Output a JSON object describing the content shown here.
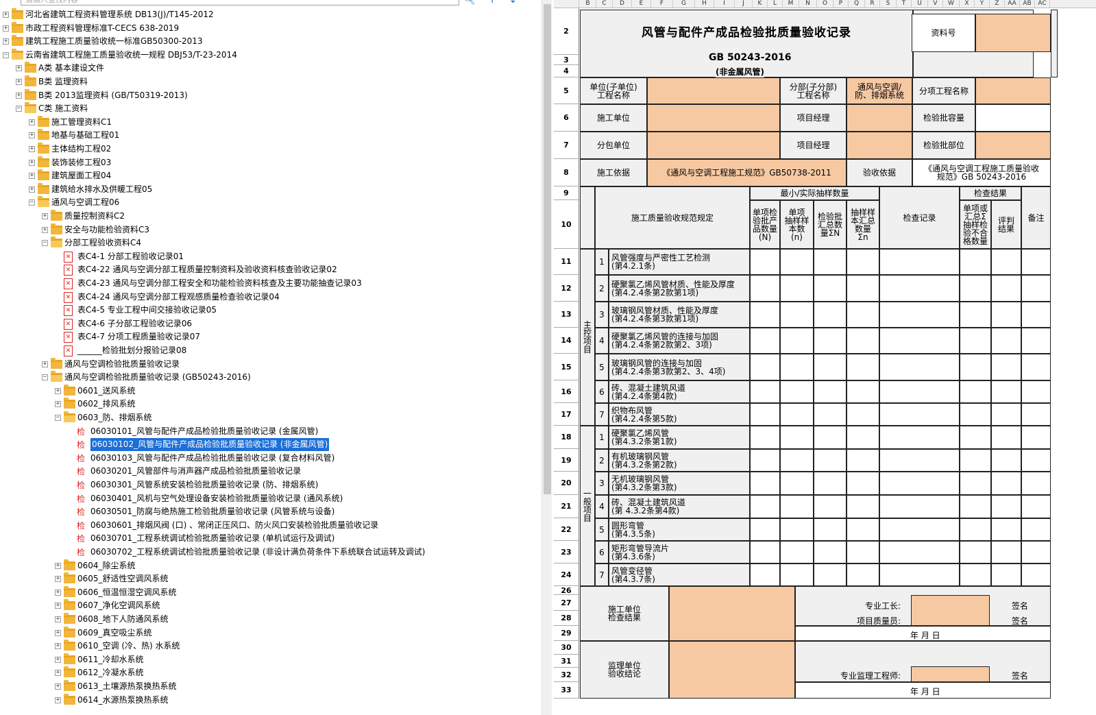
{
  "search": {
    "placeholder": "请输入查找内容"
  },
  "tree": {
    "n0": "河北省建筑工程资料管理系统 DB13(J)/T145-2012",
    "n1": "市政工程资料管理标准T-CECS 638-2019",
    "n2": "建筑工程施工质量验收统一标准GB50300-2013",
    "n3": "云南省建筑工程施工质量验收统一规程 DBJ53/T-23-2014",
    "n4": "A类 基本建设文件",
    "n5": "B类 监理资料",
    "n6": "B类 2013监理资料 (GB/T50319-2013)",
    "n7": "C类 施工资料",
    "n8": "施工管理资料C1",
    "n9": "地基与基础工程01",
    "n10": "主体结构工程02",
    "n11": "装饰装修工程03",
    "n12": "建筑屋面工程04",
    "n13": "建筑给水排水及供暖工程05",
    "n14": "通风与空调工程06",
    "n15": "质量控制资料C2",
    "n16": "安全与功能检验资料C3",
    "n17": "分部工程验收资料C4",
    "n18": "表C4-1 分部工程验收记录01",
    "n19": "表C4-22 通风与空调分部工程质量控制资料及验收资料核查验收记录02",
    "n20": "表C4-23 通风与空调分部工程安全和功能检验资料核查及主要功能抽查记录03",
    "n21": "表C4-24 通风与空调分部工程观感质量检查验收记录04",
    "n22": "表C4-5 专业工程中间交接验收记录05",
    "n23": "表C4-6 子分部工程验收记录06",
    "n24": "表C4-7 分项工程质量验收记录07",
    "n25": "______检验批划分报验记录08",
    "n26": "通风与空调检验批质量验收记录",
    "n27": "通风与空调检验批质量验收记录 (GB50243-2016)",
    "n28": "0601_送风系统",
    "n29": "0602_排风系统",
    "n30": "0603_防、排烟系统",
    "n31": "06030101_风管与配件产成品检验批质量验收记录 (金属风管)",
    "n32": "06030102_风管与配件产成品检验批质量验收记录 (非金属风管)",
    "n33": "06030103_风管与配件产成品检验批质量验收记录 (复合材料风管)",
    "n34": "06030201_风管部件与消声器产成品检验批质量验收记录",
    "n35": "06030301_风管系统安装检验批质量验收记录 (防、排烟系统)",
    "n36": "06030401_风机与空气处理设备安装检验批质量验收记录 (通风系统)",
    "n37": "06030501_防腐与绝热施工检验批质量验收记录 (风管系统与设备)",
    "n38": "06030601_排烟风阀 (口) 、常闭正压风口、防火风口安装检验批质量验收记录",
    "n39": "06030701_工程系统调试检验批质量验收记录 (单机试运行及调试)",
    "n40": "06030702_工程系统调试检验批质量验收记录 (非设计满负荷条件下系统联合试运转及调试)",
    "n41": "0604_除尘系统",
    "n42": "0605_舒适性空调风系统",
    "n43": "0606_恒温恒湿空调风系统",
    "n44": "0607_净化空调风系统",
    "n45": "0608_地下人防通风系统",
    "n46": "0609_真空吸尘系统",
    "n47": "0610_空调 (冷、热) 水系统",
    "n48": "0611_冷却水系统",
    "n49": "0612_冷凝水系统",
    "n50": "0613_土壤源热泵换热系统",
    "n51": "0614_水源热泵换热系统"
  },
  "columns": [
    "B",
    "C",
    "D",
    "E",
    "F",
    "G",
    "H",
    "I",
    "J",
    "K",
    "L",
    "M",
    "N",
    "O",
    "P",
    "Q",
    "R",
    "S",
    "T",
    "U",
    "V",
    "W",
    "X",
    "Y",
    "Z",
    "AA",
    "AB",
    "AC"
  ],
  "rows": [
    "2",
    "3",
    "4",
    "5",
    "6",
    "7",
    "8",
    "9",
    "10",
    "11",
    "12",
    "13",
    "14",
    "15",
    "16",
    "17",
    "18",
    "19",
    "20",
    "21",
    "22",
    "23",
    "24",
    "26",
    "27",
    "28",
    "29",
    "30",
    "31",
    "32",
    "33"
  ],
  "form": {
    "title": "风管与配件产成品检验批质量验收记录",
    "ziliao": "资料号",
    "std": "GB 50243-2016",
    "sub": "(非金属风管)",
    "unit_name": "单位(子单位)\n工程名称",
    "fenbu": "分部(子分部)\n工程名称",
    "fenbu_val": "通风与空调/\n防、排烟系统",
    "fenxiang": "分项工程名称",
    "sg_unit": "施工单位",
    "pm": "项目经理",
    "jyp_rl": "检验批容量",
    "fb_unit": "分包单位",
    "pm2": "项目经理",
    "jyp_bw": "检验批部位",
    "sg_yj": "施工依据",
    "sg_yj_val": "《通风与空调工程施工规范》GB50738-2011",
    "ys_yj": "验收依据",
    "ys_yj_val": "《通风与空调工程施工质量验收\n规范》GB 50243-2016",
    "min_sample": "最小/实际抽样数量",
    "jc_result": "检查结果",
    "spec": "施工质量验收规范规定",
    "h1": "单项检\n验批产\n品数量\n(N)",
    "h2": "单项\n抽样样\n本数\n(n)",
    "h3": "检验批\n汇总数\n量ΣN",
    "h4": "抽样样\n本汇总\n数量\nΣn",
    "jc_record": "检查记录",
    "h5": "单项或\n汇总Σ\n抽样检\n验不合\n格数量",
    "h6": "评判\n结果",
    "remark": "备注",
    "main_label": "主\n控\n项\n目",
    "gen_label": "一\n般\n项\n目",
    "main_items": [
      {
        "no": "1",
        "text": "风管强度与严密性工艺检测\n(第4.2.1条)"
      },
      {
        "no": "2",
        "text": "硬聚氯乙烯风管材质、性能及厚度\n(第4.2.4条第2款第1项)"
      },
      {
        "no": "3",
        "text": "玻璃钢风管材质、性能及厚度\n(第4.2.4条第3款第1项)"
      },
      {
        "no": "4",
        "text": "硬聚氯乙烯风管的连接与加固\n(第4.2.4条第2款第2、3项)"
      },
      {
        "no": "5",
        "text": "玻璃钢风管的连接与加固\n(第4.2.4条第3款第2、3、4项)"
      },
      {
        "no": "6",
        "text": "砖、混凝土建筑风道\n(第4.2.4条第4款)"
      },
      {
        "no": "7",
        "text": "织物布风管\n(第4.2.4条第5款)"
      }
    ],
    "gen_items": [
      {
        "no": "1",
        "text": "硬聚氯乙烯风管\n(第4.3.2条第1款)"
      },
      {
        "no": "2",
        "text": "有机玻璃钢风管\n(第4.3.2条第2款)"
      },
      {
        "no": "3",
        "text": "无机玻璃钢风管\n(第4.3.2条第3款)"
      },
      {
        "no": "4",
        "text": "砖、混凝土建筑风道\n(第 4.3.2条第4款)"
      },
      {
        "no": "5",
        "text": "圆形弯管\n(第4.3.5条)"
      },
      {
        "no": "6",
        "text": "矩形弯管导流片\n(第4.3.6条)"
      },
      {
        "no": "7",
        "text": "风管变径管\n(第4.3.7条)"
      }
    ],
    "sg_check": "施工单位\n检查结果",
    "zy_gz": "专业工长:",
    "qian1": "签名",
    "xm_zly": "项目质量员:",
    "qian2": "签名",
    "date1": "年   月   日",
    "jl_unit": "监理单位\n验收结论",
    "jl_eng": "专业监理工程师:",
    "qian3": "签名",
    "date2": "年   月   日"
  },
  "colors": {
    "fill_orange": "#f6c9a2",
    "selection": "#1c6fd9",
    "folder": "#f2b63a"
  }
}
